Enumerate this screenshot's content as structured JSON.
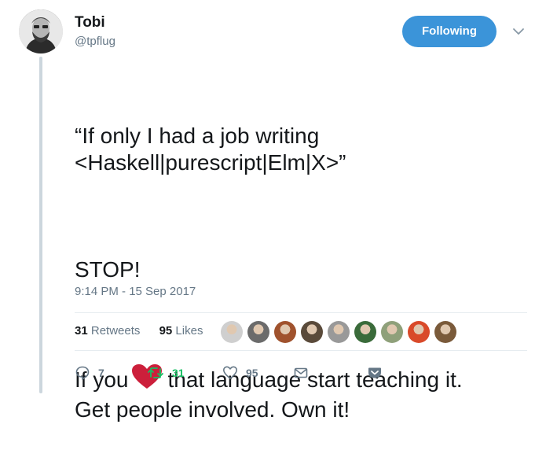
{
  "author": {
    "name": "Tobi",
    "handle": "@tpflug",
    "follow_label": "Following"
  },
  "tweet": {
    "line1": "“If only I had a job writing",
    "line2": "<Haskell|purescript|Elm|X>”",
    "stop": "STOP!",
    "teach_before": "If you",
    "teach_emoji": "heart-emoji",
    "teach_after": "that language start teaching it.",
    "teach_line2": "Get people involved. Own it!"
  },
  "timestamp": "9:14 PM - 15 Sep 2017",
  "stats": {
    "retweets_count": "31",
    "retweets_label": "Retweets",
    "likes_count": "95",
    "likes_label": "Likes"
  },
  "likers": [
    {
      "name": "liker-1",
      "color": "#cfcfcf"
    },
    {
      "name": "liker-2",
      "color": "#6b6b6b"
    },
    {
      "name": "liker-3",
      "color": "#a0522d"
    },
    {
      "name": "liker-4",
      "color": "#5a4a3a"
    },
    {
      "name": "liker-5",
      "color": "#999999"
    },
    {
      "name": "liker-6",
      "color": "#3a6b3a"
    },
    {
      "name": "liker-7",
      "color": "#8fa07a"
    },
    {
      "name": "liker-8",
      "color": "#d94a2a"
    },
    {
      "name": "liker-9",
      "color": "#7a5a3a"
    }
  ],
  "actions": {
    "reply_count": "7",
    "retweet_count": "31",
    "like_count": "95"
  },
  "colors": {
    "follow_button": "#3b94d9",
    "retweet_green": "#17bf63",
    "heart_red": "#e0245e",
    "muted": "#657786"
  }
}
